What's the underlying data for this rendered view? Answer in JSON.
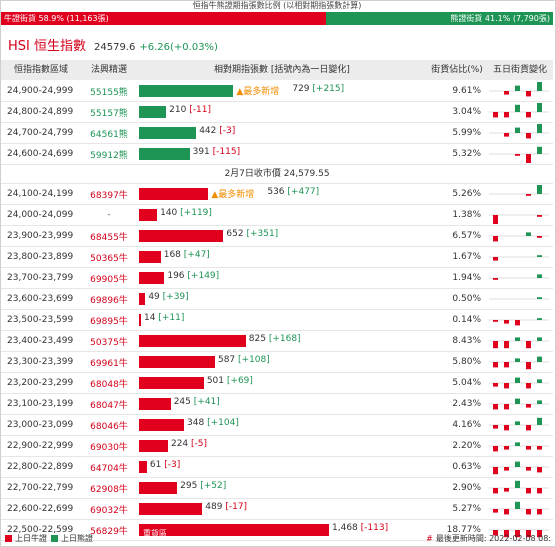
{
  "top_caption": "恒指牛熊證期指張數比例 (以相對期指張數計算)",
  "ratio": {
    "bull_label": "牛證街貨 58.9% (11,163張)",
    "bear_label": "熊證街貨 41.1% (7,790張)",
    "bull_fraction": 0.589
  },
  "index": {
    "name": "HSI 恒生指數",
    "value": "24579.6",
    "change": "+6.26(+0.03%)"
  },
  "header": {
    "range": "恒指指數區域",
    "code": "法興精選",
    "bars": "相對期指張數 [括號內為一日變化]",
    "pct": "街貨佔比(%)",
    "spark": "五日街貨變化"
  },
  "close_label": "2月7日收市價 24,579.55",
  "rows_top": [
    {
      "range": "24,900-24,999",
      "code": "55155熊",
      "side": "bear",
      "value": 729,
      "value_text": "729",
      "change": "[+215]",
      "dir": "pos",
      "pct": "9.61%",
      "tag": "最多新增",
      "spark": [
        0,
        -2,
        3,
        -3,
        5
      ]
    },
    {
      "range": "24,800-24,899",
      "code": "55157熊",
      "side": "bear",
      "value": 210,
      "value_text": "210",
      "change": "[-11]",
      "dir": "neg",
      "pct": "3.04%",
      "spark": [
        -3,
        -3,
        4,
        -3,
        5
      ]
    },
    {
      "range": "24,700-24,799",
      "code": "64561熊",
      "side": "bear",
      "value": 442,
      "value_text": "442",
      "change": "[-3]",
      "dir": "neg",
      "pct": "5.99%",
      "spark": [
        0,
        -2,
        3,
        -3,
        5
      ]
    },
    {
      "range": "24,600-24,699",
      "code": "59912熊",
      "side": "bear",
      "value": 391,
      "value_text": "391",
      "change": "[-115]",
      "dir": "neg",
      "pct": "5.32%",
      "spark": [
        0,
        0,
        -1,
        -5,
        4
      ]
    }
  ],
  "rows_bottom": [
    {
      "range": "24,100-24,199",
      "code": "68397牛",
      "side": "bull",
      "value": 536,
      "value_text": "536",
      "change": "[+477]",
      "dir": "pos",
      "pct": "5.26%",
      "tag": "最多新增",
      "spark": [
        0,
        0,
        0,
        -1,
        5
      ]
    },
    {
      "range": "24,000-24,099",
      "code": "-",
      "side": "none",
      "value": 140,
      "value_text": "140",
      "change": "[+119]",
      "dir": "pos",
      "pct": "1.38%",
      "spark": [
        -5,
        0,
        0,
        0,
        -1
      ]
    },
    {
      "range": "23,900-23,999",
      "code": "68455牛",
      "side": "bull",
      "value": 652,
      "value_text": "652",
      "change": "[+351]",
      "dir": "pos",
      "pct": "6.57%",
      "spark": [
        -3,
        0,
        0,
        2,
        -1
      ]
    },
    {
      "range": "23,800-23,899",
      "code": "50365牛",
      "side": "bull",
      "value": 168,
      "value_text": "168",
      "change": "[+47]",
      "dir": "pos",
      "pct": "1.67%",
      "spark": [
        -2,
        0,
        0,
        0,
        1
      ]
    },
    {
      "range": "23,700-23,799",
      "code": "69905牛",
      "side": "bull",
      "value": 196,
      "value_text": "196",
      "change": "[+149]",
      "dir": "pos",
      "pct": "1.94%",
      "spark": [
        -1,
        0,
        0,
        0,
        2
      ]
    },
    {
      "range": "23,600-23,699",
      "code": "69896牛",
      "side": "bull",
      "value": 49,
      "value_text": "49",
      "change": "[+39]",
      "dir": "pos",
      "pct": "0.50%",
      "spark": [
        0,
        0,
        0,
        0,
        1
      ]
    },
    {
      "range": "23,500-23,599",
      "code": "69895牛",
      "side": "bull",
      "value": 14,
      "value_text": "14",
      "change": "[+11]",
      "dir": "pos",
      "pct": "0.14%",
      "spark": [
        -1,
        -2,
        -3,
        0,
        1
      ]
    },
    {
      "range": "23,400-23,499",
      "code": "50375牛",
      "side": "bull",
      "value": 825,
      "value_text": "825",
      "change": "[+168]",
      "dir": "pos",
      "pct": "8.43%",
      "spark": [
        -4,
        -4,
        2,
        -4,
        2
      ]
    },
    {
      "range": "23,300-23,399",
      "code": "69961牛",
      "side": "bull",
      "value": 587,
      "value_text": "587",
      "change": "[+108]",
      "dir": "pos",
      "pct": "5.80%",
      "spark": [
        -3,
        -3,
        2,
        -4,
        3
      ]
    },
    {
      "range": "23,200-23,299",
      "code": "68048牛",
      "side": "bull",
      "value": 501,
      "value_text": "501",
      "change": "[+69]",
      "dir": "pos",
      "pct": "5.04%",
      "spark": [
        -2,
        -3,
        3,
        -3,
        2
      ]
    },
    {
      "range": "23,100-23,199",
      "code": "68047牛",
      "side": "bull",
      "value": 245,
      "value_text": "245",
      "change": "[+41]",
      "dir": "pos",
      "pct": "2.43%",
      "spark": [
        -3,
        -3,
        3,
        -2,
        2
      ]
    },
    {
      "range": "23,000-23,099",
      "code": "68046牛",
      "side": "bull",
      "value": 348,
      "value_text": "348",
      "change": "[+104]",
      "dir": "pos",
      "pct": "4.16%",
      "spark": [
        -2,
        -3,
        2,
        -3,
        4
      ]
    },
    {
      "range": "22,900-22,999",
      "code": "69030牛",
      "side": "bull",
      "value": 224,
      "value_text": "224",
      "change": "[-5]",
      "dir": "neg",
      "pct": "2.20%",
      "spark": [
        -3,
        -2,
        2,
        -2,
        -2
      ]
    },
    {
      "range": "22,800-22,899",
      "code": "64704牛",
      "side": "bull",
      "value": 61,
      "value_text": "61",
      "change": "[-3]",
      "dir": "neg",
      "pct": "0.63%",
      "spark": [
        -4,
        -2,
        3,
        -2,
        -3
      ]
    },
    {
      "range": "22,700-22,799",
      "code": "62908牛",
      "side": "bull",
      "value": 295,
      "value_text": "295",
      "change": "[+52]",
      "dir": "pos",
      "pct": "2.90%",
      "spark": [
        -3,
        -2,
        4,
        -3,
        -3
      ]
    },
    {
      "range": "22,600-22,699",
      "code": "69032牛",
      "side": "bull",
      "value": 489,
      "value_text": "489",
      "change": "[-17]",
      "dir": "neg",
      "pct": "5.27%",
      "spark": [
        -2,
        -3,
        4,
        -3,
        -3
      ]
    },
    {
      "range": "22,500-22,599",
      "code": "56829牛",
      "side": "bull",
      "value": 1468,
      "value_text": "1,468",
      "change": "[-113]",
      "dir": "neg",
      "pct": "18.77%",
      "heavy": "重貨區",
      "spark": [
        -3,
        -4,
        -4,
        -4,
        -4
      ]
    }
  ],
  "footer": {
    "bull_legend": "上日牛證",
    "bear_legend": "上日熊證",
    "update_label": "最後更新時間: 2022-02-08 08:",
    "bull_color": "#e0001e",
    "bear_color": "#1e9455"
  }
}
